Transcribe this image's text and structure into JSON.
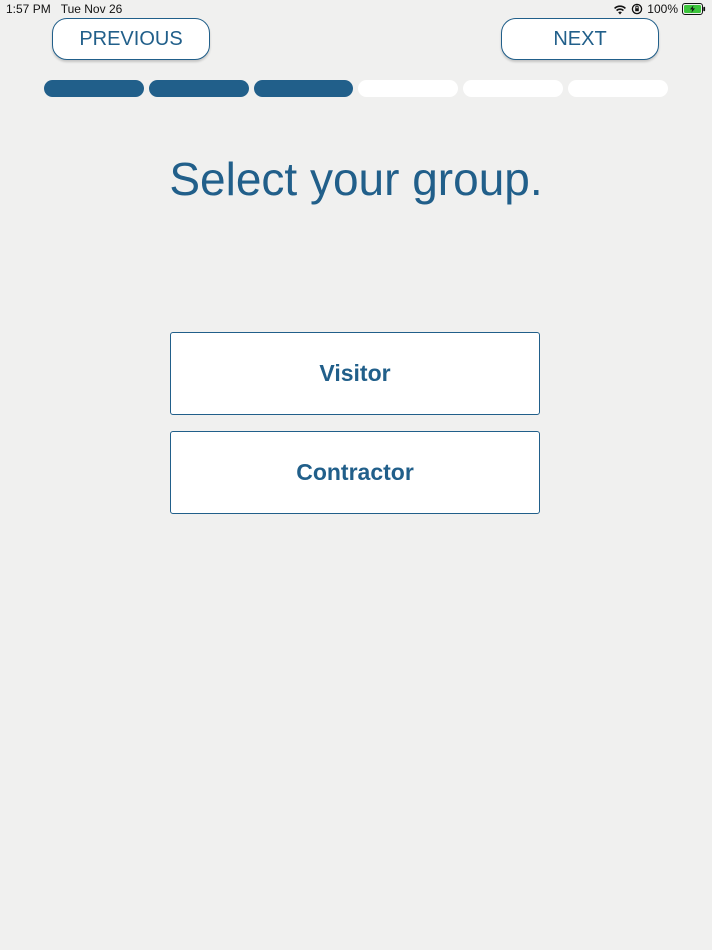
{
  "status_bar": {
    "time": "1:57 PM",
    "date": "Tue Nov 26",
    "battery_percent": "100%",
    "icons": [
      "wifi-icon",
      "orientation-lock-icon",
      "battery-charging-icon"
    ]
  },
  "nav": {
    "previous_label": "PREVIOUS",
    "next_label": "NEXT"
  },
  "progress": {
    "total_steps": 6,
    "completed_steps": 3,
    "active_color": "#215f8a",
    "inactive_color": "#ffffff"
  },
  "main": {
    "title": "Select your group.",
    "options": [
      {
        "label": "Visitor"
      },
      {
        "label": "Contractor"
      }
    ]
  },
  "colors": {
    "accent": "#215f8a",
    "background": "#f0f0ef"
  }
}
